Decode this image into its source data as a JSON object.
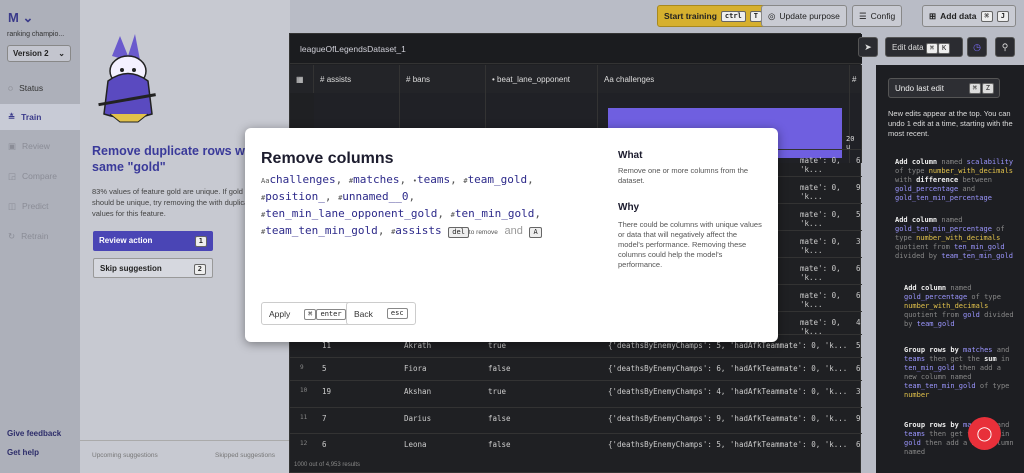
{
  "nav": {
    "logo": "M",
    "project": "ranking champio...",
    "version": "Version 2",
    "items": [
      {
        "label": "Status",
        "icon": "status-icon"
      },
      {
        "label": "Train",
        "icon": "train-icon"
      },
      {
        "label": "Review",
        "icon": "review-icon"
      },
      {
        "label": "Compare",
        "icon": "compare-icon"
      },
      {
        "label": "Predict",
        "icon": "predict-icon"
      },
      {
        "label": "Retrain",
        "icon": "retrain-icon"
      }
    ],
    "feedback": "Give feedback",
    "help": "Get help"
  },
  "suggestion": {
    "title": "Remove duplicate rows wi same \"gold\"",
    "description": "83% values of feature gold are unique. If gold should be unique, try removing the with duplicate values for this feature.",
    "review_label": "Review action",
    "review_key": "1",
    "skip_label": "Skip suggestion",
    "skip_key": "2",
    "upcoming": "Upcoming suggestions",
    "skipped": "Skipped suggestions"
  },
  "toolbar": {
    "start_training": "Start training",
    "start_keys": [
      "ctrl",
      "T"
    ],
    "update_purpose": "Update purpose",
    "config": "Config",
    "add_data": "Add data",
    "add_keys": [
      "⌘",
      "J"
    ]
  },
  "table": {
    "name": "leagueOfLegendsDataset_1",
    "edit_data": "Edit data",
    "edit_keys": [
      "⌘",
      "K"
    ],
    "columns": [
      {
        "type": "#",
        "name": "assists"
      },
      {
        "type": "#",
        "name": "bans"
      },
      {
        "type": "•",
        "name": "beat_lane_opponent"
      },
      {
        "type": "Aa",
        "name": "challenges"
      },
      {
        "type": "#",
        "name": "d"
      }
    ],
    "histogram_label": "20 u",
    "rows": [
      {
        "n": "",
        "assists": "11",
        "champ": "Akrath",
        "beat": "true",
        "chal": "{'deathsByEnemyChamps': 5, 'hadAfkTeammate': 0, 'k...",
        "d": "5"
      },
      {
        "n": "9",
        "assists": "5",
        "champ": "Fiora",
        "beat": "false",
        "chal": "{'deathsByEnemyChamps': 6, 'hadAfkTeammate': 0, 'k...",
        "d": "6"
      },
      {
        "n": "10",
        "assists": "19",
        "champ": "Akshan",
        "beat": "true",
        "chal": "{'deathsByEnemyChamps': 4, 'hadAfkTeammate': 0, 'k...",
        "d": "3"
      },
      {
        "n": "11",
        "assists": "7",
        "champ": "Darius",
        "beat": "false",
        "chal": "{'deathsByEnemyChamps': 9, 'hadAfkTeammate': 0, 'k...",
        "d": "9"
      },
      {
        "n": "12",
        "assists": "6",
        "champ": "Leona",
        "beat": "false",
        "chal": "{'deathsByEnemyChamps': 5, 'hadAfkTeammate': 0, 'k...",
        "d": "6"
      }
    ],
    "partial_rows": [
      {
        "chal": "mate': 0, 'k...",
        "d": "6"
      },
      {
        "chal": "mate': 0, 'k...",
        "d": "9"
      },
      {
        "chal": "mate': 0, 'k...",
        "d": "5"
      },
      {
        "chal": "mate': 0, 'k...",
        "d": "3"
      },
      {
        "chal": "mate': 0, 'k...",
        "d": "6"
      },
      {
        "chal": "mate': 0, 'k...",
        "d": "6"
      },
      {
        "chal": "mate': 0, 'k...",
        "d": "4"
      }
    ],
    "footer": "1000 out of 4,953 results"
  },
  "edits": {
    "undo_label": "Undo last edit",
    "undo_keys": [
      "⌘",
      "Z"
    ],
    "note": "New edits appear at the top. You can undo 1 edit at a time, starting with the most recent."
  },
  "modal": {
    "title": "Remove columns",
    "columns": [
      {
        "icon": "Aa",
        "name": "challenges"
      },
      {
        "icon": "#",
        "name": "matches"
      },
      {
        "icon": "•",
        "name": "teams"
      },
      {
        "icon": "#",
        "name": "team_gold"
      },
      {
        "icon": "#",
        "name": "position_"
      },
      {
        "icon": "#",
        "name": "unnamed__0"
      },
      {
        "icon": "#",
        "name": "ten_min_lane_opponent_gold"
      },
      {
        "icon": "#",
        "name": "ten_min_gold"
      },
      {
        "icon": "#",
        "name": "team_ten_min_gold"
      },
      {
        "icon": "#",
        "name": "assists"
      }
    ],
    "del_key": "del",
    "to_remove": "to remove",
    "and": "and",
    "and_key": "A",
    "what_title": "What",
    "what_text": "Remove one or more columns from the dataset.",
    "why_title": "Why",
    "why_text": "There could be columns with unique values or data that will negatively affect the model's performance. Removing these columns could help the model's performance.",
    "apply": "Apply",
    "apply_keys": [
      "⌘",
      "enter"
    ],
    "back": "Back",
    "back_key": "esc"
  }
}
